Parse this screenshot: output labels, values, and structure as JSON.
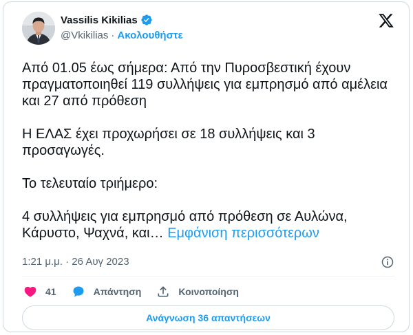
{
  "author": {
    "display_name": "Vassilis Kikilias",
    "handle": "@Vkikilias",
    "separator": "·",
    "follow_label": "Ακολουθήστε"
  },
  "tweet": {
    "paragraphs": [
      "Από 01.05 έως σήμερα: Από την Πυροσβεστική έχουν πραγματοποιηθεί 119 συλλήψεις για εμπρησμό από αμέλεια και 27 από πρόθεση",
      "Η ΕΛΑΣ έχει προχωρήσει σε 18 συλλήψεις και 3 προσαγωγές.",
      "Το τελευταίο τριήμερο:"
    ],
    "last_paragraph": "4 συλλήψεις για εμπρησμό από πρόθεση σε Αυλώνα, Κάρυστο, Ψαχνά, και…",
    "show_more_label": "Εμφάνιση περισσότερων",
    "timestamp": "1:21 μ.μ. · 26 Αυγ 2023"
  },
  "actions": {
    "like_count": "41",
    "reply_label": "Απάντηση",
    "share_label": "Κοινοποίηση"
  },
  "read_replies_label": "Ανάγνωση 36 απαντήσεων",
  "icons": {
    "verified": "verified-badge-icon",
    "platform": "x-logo-icon",
    "info": "info-icon",
    "like": "heart-icon",
    "reply": "speech-bubble-icon",
    "share": "share-upload-icon"
  },
  "colors": {
    "accent": "#1d9bf0",
    "like": "#f91880",
    "text": "#0f1419",
    "muted": "#536471",
    "border": "#cfd9de"
  }
}
